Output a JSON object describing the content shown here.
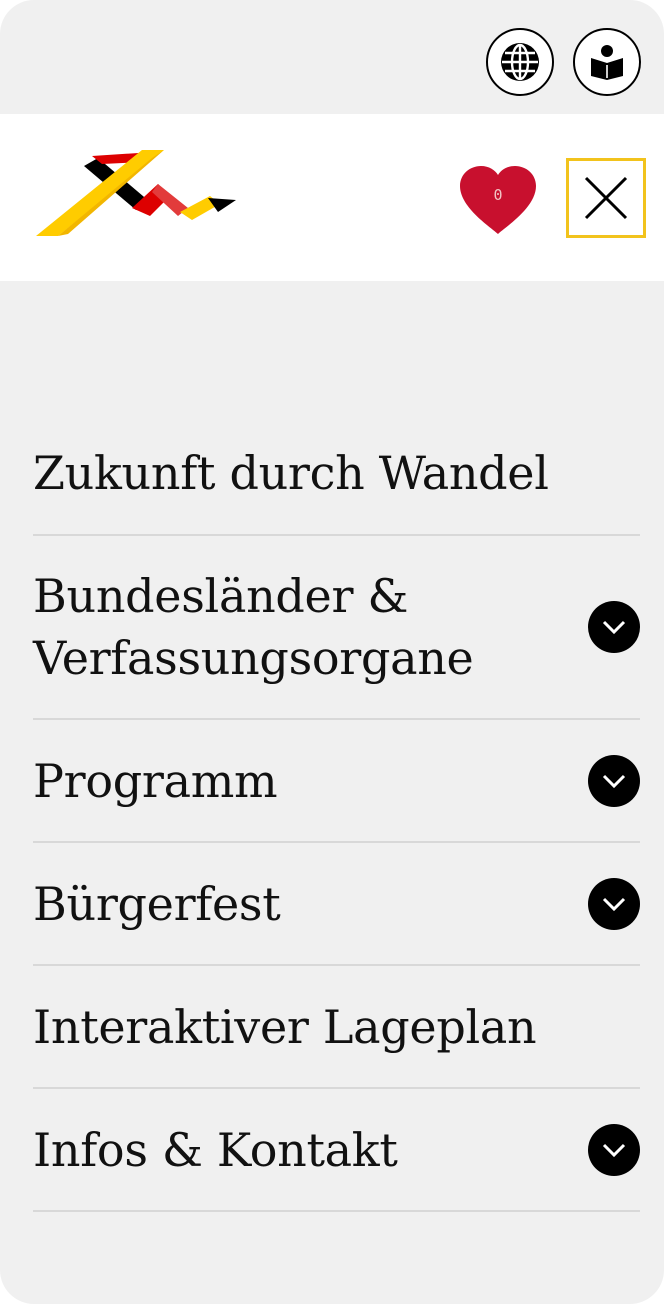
{
  "header": {
    "favorites_count": "0"
  },
  "menu": {
    "items": [
      {
        "label": "Zukunft durch Wandel",
        "has_submenu": false
      },
      {
        "label": "Bundesländer & Verfassungsorgane",
        "has_submenu": true
      },
      {
        "label": "Programm",
        "has_submenu": true
      },
      {
        "label": "Bürgerfest",
        "has_submenu": true
      },
      {
        "label": "Interaktiver Lageplan",
        "has_submenu": false
      },
      {
        "label": "Infos & Kontakt",
        "has_submenu": true
      }
    ]
  },
  "icons": {
    "language": "globe-icon",
    "easy_read": "reader-icon",
    "favorites": "heart-icon",
    "close": "close-icon",
    "expand": "chevron-down-icon"
  },
  "colors": {
    "background": "#f0f0f0",
    "header": "#ffffff",
    "heart": "#c8102e",
    "focus": "#f2c31c",
    "text": "#111111",
    "logo_black": "#000000",
    "logo_red": "#dd0000",
    "logo_gold": "#ffcc00"
  }
}
